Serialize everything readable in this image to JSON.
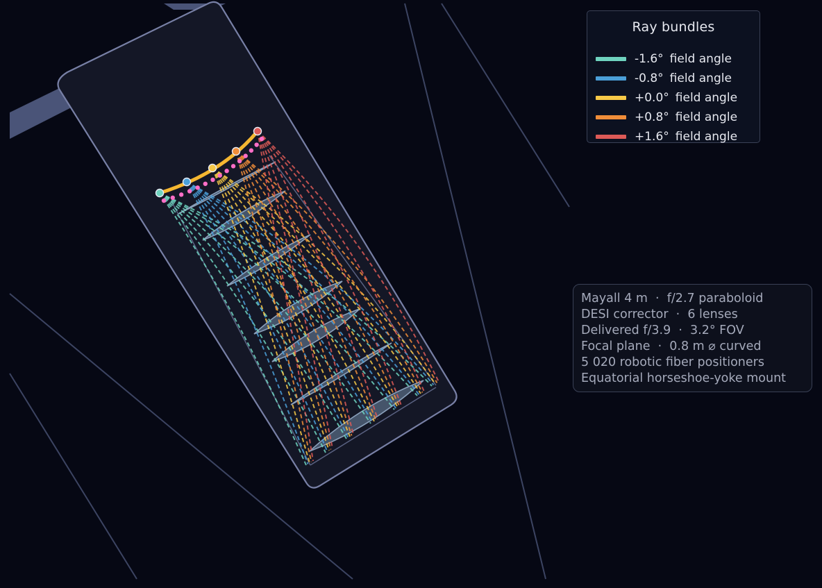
{
  "legend": {
    "title": "Ray bundles",
    "items": [
      {
        "angle": "-1.6°",
        "suffix": "field angle",
        "color": "#6fd3bf"
      },
      {
        "angle": "-0.8°",
        "suffix": "field angle",
        "color": "#4b9fd8"
      },
      {
        "angle": "+0.0°",
        "suffix": "field angle",
        "color": "#f7c948"
      },
      {
        "angle": "+0.8°",
        "suffix": "field angle",
        "color": "#f08d39"
      },
      {
        "angle": "+1.6°",
        "suffix": "field angle",
        "color": "#dc5a57"
      }
    ]
  },
  "info": {
    "lines": [
      "Mayall 4 m  ·  f/2.7 paraboloid",
      "DESI corrector  ·  6 lenses",
      "Delivered f/3.9  ·  3.2° FOV",
      "Focal plane  ·  0.8 m ⌀ curved",
      "5 020 robotic fiber positioners",
      "Equatorial horseshoe-yoke mount"
    ]
  },
  "colors": {
    "background": "#060814",
    "tube_fill": "#141726",
    "tube_stroke": "#7880a6",
    "lens_fill": "#6e86a3",
    "focal_plane": "#f5b731",
    "fiber_dots": "#ff6ec7"
  }
}
